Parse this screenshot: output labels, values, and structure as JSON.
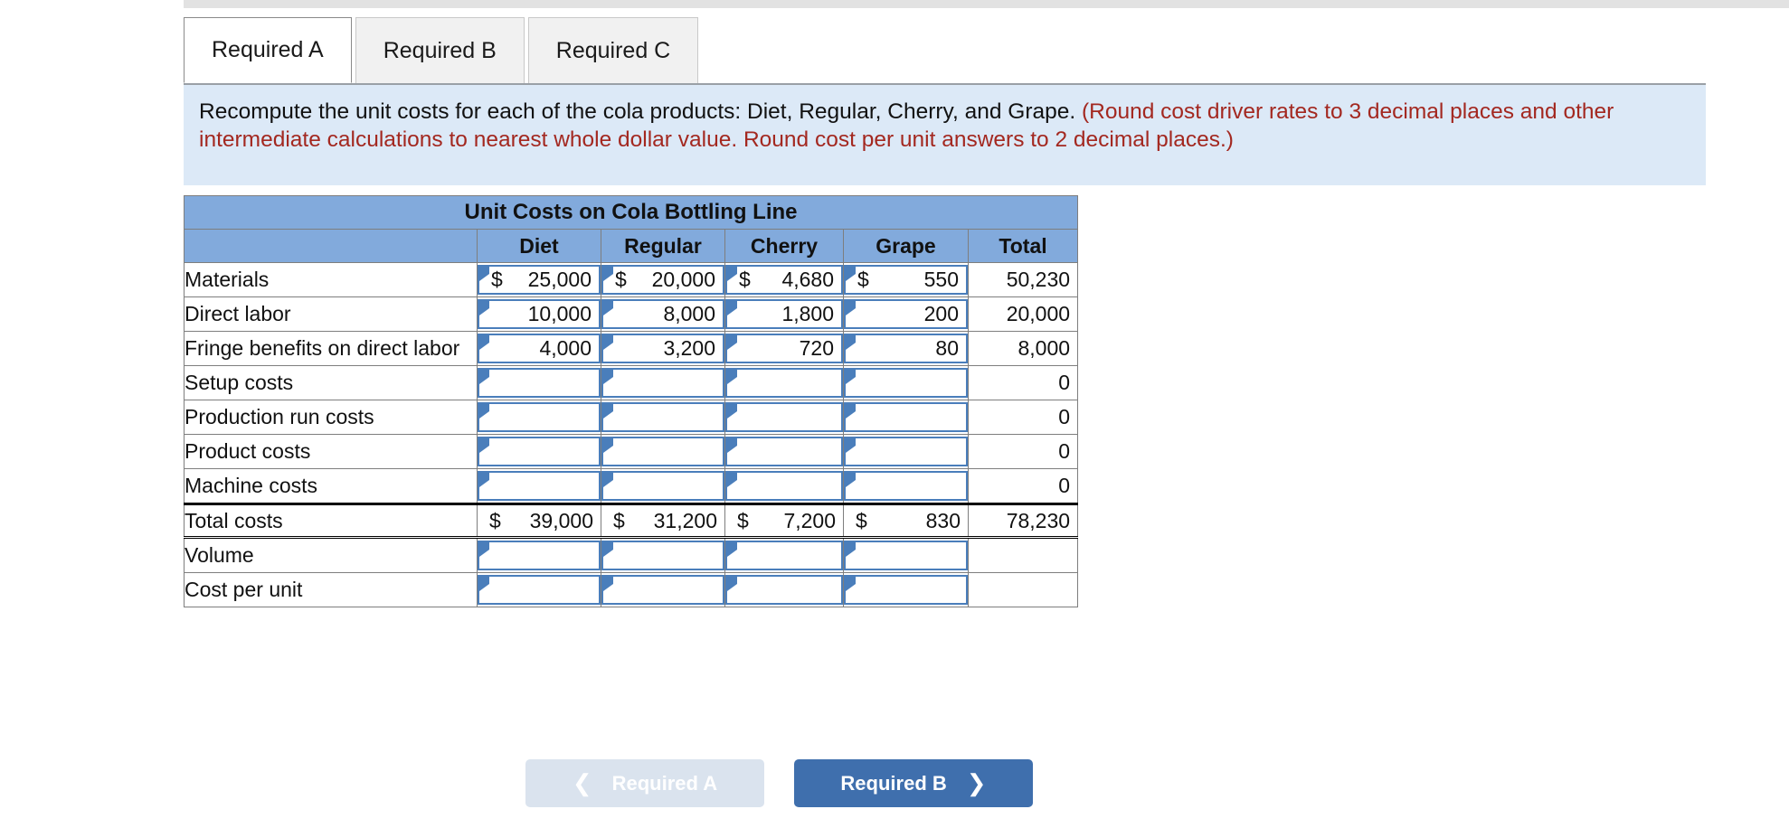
{
  "tabs": [
    {
      "label": "Required A",
      "active": true
    },
    {
      "label": "Required B",
      "active": false
    },
    {
      "label": "Required C",
      "active": false
    }
  ],
  "instruction": {
    "main": "Recompute the unit costs for each of the cola products: Diet, Regular, Cherry, and Grape.",
    "note": "(Round cost driver rates to 3 decimal places and other intermediate calculations to nearest whole dollar value. Round cost per unit answers to 2 decimal places.)"
  },
  "table": {
    "title": "Unit Costs on Cola Bottling Line",
    "columns": [
      "",
      "Diet",
      "Regular",
      "Cherry",
      "Grape",
      "Total"
    ],
    "rows": [
      {
        "label": "Materials",
        "diet": "25,000",
        "regular": "20,000",
        "cherry": "4,680",
        "grape": "550",
        "total": "50,230",
        "dollar": true,
        "input": true,
        "total_input": false
      },
      {
        "label": "Direct labor",
        "diet": "10,000",
        "regular": "8,000",
        "cherry": "1,800",
        "grape": "200",
        "total": "20,000",
        "dollar": false,
        "input": true,
        "total_input": false
      },
      {
        "label": "Fringe benefits on direct labor",
        "diet": "4,000",
        "regular": "3,200",
        "cherry": "720",
        "grape": "80",
        "total": "8,000",
        "dollar": false,
        "input": true,
        "total_input": false
      },
      {
        "label": "Setup costs",
        "diet": "",
        "regular": "",
        "cherry": "",
        "grape": "",
        "total": "0",
        "dollar": false,
        "input": true,
        "total_input": false
      },
      {
        "label": "Production run costs",
        "diet": "",
        "regular": "",
        "cherry": "",
        "grape": "",
        "total": "0",
        "dollar": false,
        "input": true,
        "total_input": false
      },
      {
        "label": "Product costs",
        "diet": "",
        "regular": "",
        "cherry": "",
        "grape": "",
        "total": "0",
        "dollar": false,
        "input": true,
        "total_input": false
      },
      {
        "label": "Machine costs",
        "diet": "",
        "regular": "",
        "cherry": "",
        "grape": "",
        "total": "0",
        "dollar": false,
        "input": true,
        "total_input": false
      },
      {
        "label": "Total costs",
        "diet": "39,000",
        "regular": "31,200",
        "cherry": "7,200",
        "grape": "830",
        "total": "78,230",
        "dollar": true,
        "input": false,
        "total_input": false,
        "is_total": true
      },
      {
        "label": "Volume",
        "diet": "",
        "regular": "",
        "cherry": "",
        "grape": "",
        "total": "",
        "dollar": false,
        "input": true,
        "total_input": false
      },
      {
        "label": "Cost per unit",
        "diet": "",
        "regular": "",
        "cherry": "",
        "grape": "",
        "total": "",
        "dollar": false,
        "input": true,
        "total_input": false
      }
    ]
  },
  "footer": {
    "prev_label": "Required A",
    "next_label": "Required B",
    "prev_icon": "chevron-left-icon",
    "next_icon": "chevron-right-icon"
  },
  "colors": {
    "header_blue": "#82aadc",
    "banner_blue": "#dce9f7",
    "note_red": "#a32820",
    "input_border": "#4a7ebb",
    "primary_button": "#3f6fad",
    "disabled_button": "#dae3ee"
  }
}
